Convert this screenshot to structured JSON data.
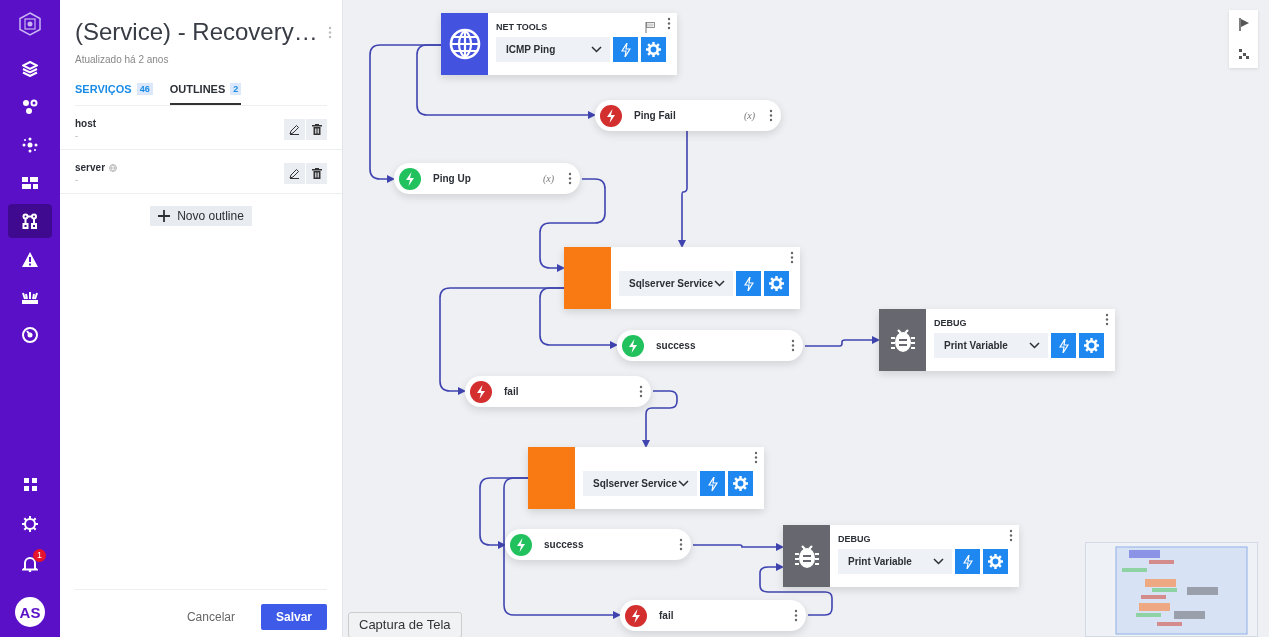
{
  "sidebar": {
    "items": [
      {
        "selected": false
      },
      {
        "selected": false
      },
      {
        "selected": false
      },
      {
        "selected": false
      },
      {
        "selected": true
      },
      {
        "selected": false
      },
      {
        "selected": false
      },
      {
        "selected": false
      }
    ],
    "bottom_items": [
      {
        "selected": false
      },
      {
        "selected": false
      },
      {
        "selected": false,
        "badge": "1"
      }
    ],
    "avatar": "AS"
  },
  "panel": {
    "title": "(Service) - Recovery…",
    "updated": "Atualizado há 2 anos",
    "tabs": [
      {
        "label": "SERVIÇOS",
        "count": "46",
        "selected": false
      },
      {
        "label": "OUTLINES",
        "count": "2",
        "selected": true
      }
    ],
    "outlines": [
      {
        "name": "host",
        "value": "-",
        "shared": false
      },
      {
        "name": "server",
        "value": "-",
        "shared": true
      }
    ],
    "add_button": "Novo outline",
    "cancel_button": "Cancelar",
    "save_button": "Salvar"
  },
  "canvas": {
    "nodes": [
      {
        "kind": "action",
        "category": "NET TOOLS",
        "select": "ICMP Ping",
        "color": "#4353e0",
        "start": true
      },
      {
        "kind": "event",
        "label": "Ping Fail",
        "color": "#d32f2f",
        "variable": "(x)"
      },
      {
        "kind": "event",
        "label": "Ping Up",
        "color": "#21c25e",
        "variable": "(x)"
      },
      {
        "kind": "action",
        "select": "Sqlserver Service",
        "color": "#f97a12",
        "start": false
      },
      {
        "kind": "event",
        "label": "success",
        "color": "#21c25e"
      },
      {
        "kind": "action",
        "category": "DEBUG",
        "select": "Print Variable",
        "color": "#67676f",
        "start": false
      },
      {
        "kind": "event",
        "label": "fail",
        "color": "#d32f2f"
      },
      {
        "kind": "action",
        "select": "Sqlserver Service",
        "color": "#f97a12",
        "start": false
      },
      {
        "kind": "event",
        "label": "success",
        "color": "#21c25e"
      },
      {
        "kind": "action",
        "category": "DEBUG",
        "select": "Print Variable",
        "color": "#67676f",
        "start": false
      },
      {
        "kind": "event",
        "label": "fail",
        "color": "#d32f2f"
      }
    ],
    "tooltip": "Captura de Tela"
  }
}
